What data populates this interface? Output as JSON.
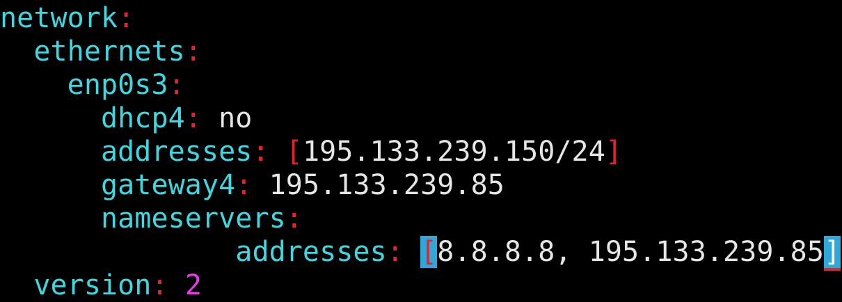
{
  "colors": {
    "background": "#000000",
    "key": "#3fd7e0",
    "colon": "#e5232d",
    "value": "#e6e6e6",
    "number": "#e63ce6",
    "highlight": "#2ea8d8"
  },
  "lines": {
    "network": {
      "key": "network",
      "colon": ":"
    },
    "ethernets": {
      "indent": "  ",
      "key": "ethernets",
      "colon": ":"
    },
    "iface": {
      "indent": "    ",
      "key": "enp0s3",
      "colon": ":"
    },
    "dhcp4": {
      "indent": "      ",
      "key": "dhcp4",
      "colon": ":",
      "value": "no"
    },
    "addresses": {
      "indent": "      ",
      "key": "addresses",
      "colon": ":",
      "open": "[",
      "value": "195.133.239.150/24",
      "close": "]"
    },
    "gateway4": {
      "indent": "      ",
      "key": "gateway4",
      "colon": ":",
      "value": "195.133.239.85"
    },
    "nameservers": {
      "indent": "      ",
      "key": "nameservers",
      "colon": ":"
    },
    "ns_addresses": {
      "indent": "              ",
      "key": "addresses",
      "colon": ":",
      "open": "[",
      "value": "8.8.8.8, 195.133.239.85",
      "close": "]"
    },
    "version": {
      "indent": "  ",
      "key": "version",
      "colon": ":",
      "value": "2"
    }
  }
}
